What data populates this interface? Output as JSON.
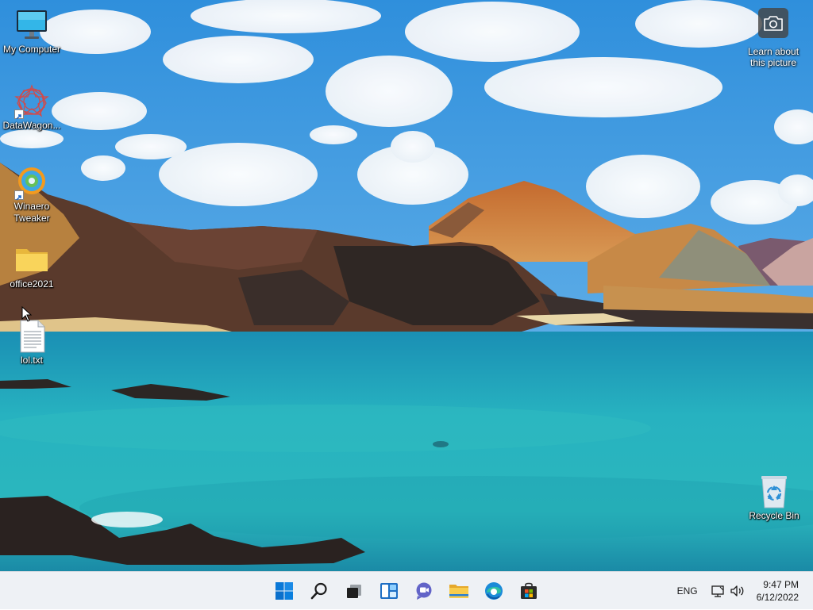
{
  "desktop": {
    "icons": [
      {
        "label": "My Computer"
      },
      {
        "label": "DataWagon..."
      },
      {
        "label": "Winaero\nTweaker"
      },
      {
        "label": "office2021"
      },
      {
        "label": "lol.txt"
      }
    ],
    "recycle_bin": {
      "label": "Recycle Bin"
    },
    "learn_picture": {
      "label": "Learn about\nthis picture"
    }
  },
  "taskbar": {
    "buttons": [
      {
        "icon": "windows-start-icon"
      },
      {
        "icon": "search-icon"
      },
      {
        "icon": "task-view-icon"
      },
      {
        "icon": "widgets-icon"
      },
      {
        "icon": "teams-chat-icon"
      },
      {
        "icon": "file-explorer-icon"
      },
      {
        "icon": "edge-icon"
      },
      {
        "icon": "store-icon"
      }
    ],
    "language": "ENG",
    "time": "9:47 PM",
    "date": "6/12/2022"
  },
  "colors": {
    "accent": "#0078d4",
    "taskbar_bg": "#eef1f5",
    "sky": "#3d9ae0",
    "sea": "#1fa9b8"
  }
}
